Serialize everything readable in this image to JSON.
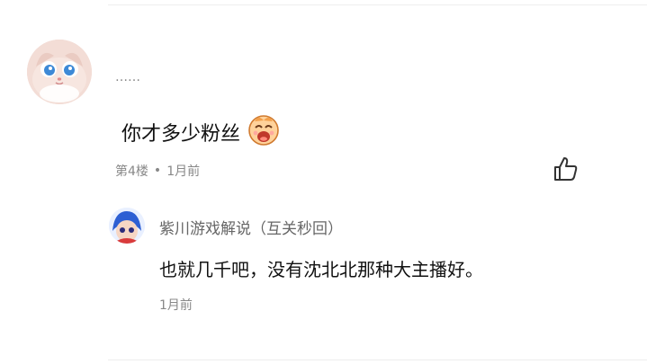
{
  "comment": {
    "username": "……",
    "text": "你才多少粉丝",
    "floor": "第4楼",
    "time": "1月前",
    "avatar_icon": "cat-avatar-icon",
    "emoji_icon": "laughing-face-emoji-icon",
    "like_icon": "thumbs-up-icon"
  },
  "reply": {
    "username": "紫川游戏解说（互关秒回）",
    "text": "也就几千吧，没有沈北北那种大主播好。",
    "time": "1月前",
    "avatar_icon": "anime-girl-avatar-icon"
  },
  "colors": {
    "text_primary": "#111111",
    "text_secondary": "#888888",
    "divider": "#eeeeee"
  }
}
